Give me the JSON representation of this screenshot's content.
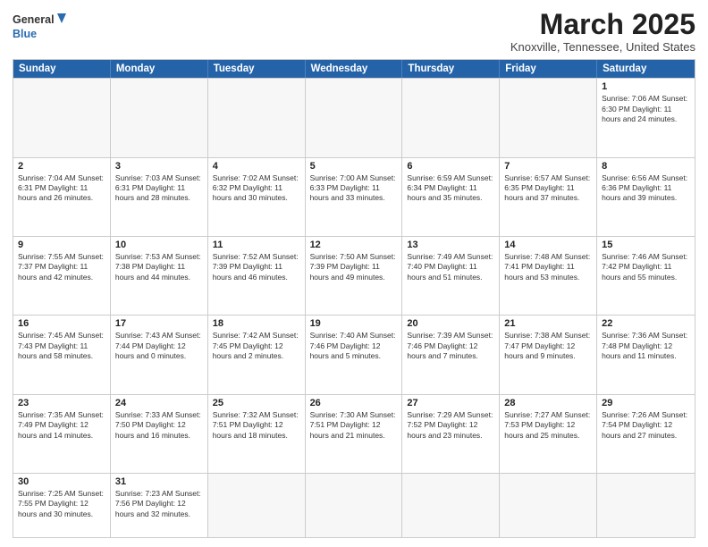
{
  "header": {
    "logo_line1": "General",
    "logo_line2": "Blue",
    "month_title": "March 2025",
    "location": "Knoxville, Tennessee, United States"
  },
  "days_of_week": [
    "Sunday",
    "Monday",
    "Tuesday",
    "Wednesday",
    "Thursday",
    "Friday",
    "Saturday"
  ],
  "weeks": [
    [
      {
        "day": "",
        "info": ""
      },
      {
        "day": "",
        "info": ""
      },
      {
        "day": "",
        "info": ""
      },
      {
        "day": "",
        "info": ""
      },
      {
        "day": "",
        "info": ""
      },
      {
        "day": "",
        "info": ""
      },
      {
        "day": "1",
        "info": "Sunrise: 7:06 AM\nSunset: 6:30 PM\nDaylight: 11 hours\nand 24 minutes."
      }
    ],
    [
      {
        "day": "2",
        "info": "Sunrise: 7:04 AM\nSunset: 6:31 PM\nDaylight: 11 hours\nand 26 minutes."
      },
      {
        "day": "3",
        "info": "Sunrise: 7:03 AM\nSunset: 6:31 PM\nDaylight: 11 hours\nand 28 minutes."
      },
      {
        "day": "4",
        "info": "Sunrise: 7:02 AM\nSunset: 6:32 PM\nDaylight: 11 hours\nand 30 minutes."
      },
      {
        "day": "5",
        "info": "Sunrise: 7:00 AM\nSunset: 6:33 PM\nDaylight: 11 hours\nand 33 minutes."
      },
      {
        "day": "6",
        "info": "Sunrise: 6:59 AM\nSunset: 6:34 PM\nDaylight: 11 hours\nand 35 minutes."
      },
      {
        "day": "7",
        "info": "Sunrise: 6:57 AM\nSunset: 6:35 PM\nDaylight: 11 hours\nand 37 minutes."
      },
      {
        "day": "8",
        "info": "Sunrise: 6:56 AM\nSunset: 6:36 PM\nDaylight: 11 hours\nand 39 minutes."
      }
    ],
    [
      {
        "day": "9",
        "info": "Sunrise: 7:55 AM\nSunset: 7:37 PM\nDaylight: 11 hours\nand 42 minutes."
      },
      {
        "day": "10",
        "info": "Sunrise: 7:53 AM\nSunset: 7:38 PM\nDaylight: 11 hours\nand 44 minutes."
      },
      {
        "day": "11",
        "info": "Sunrise: 7:52 AM\nSunset: 7:39 PM\nDaylight: 11 hours\nand 46 minutes."
      },
      {
        "day": "12",
        "info": "Sunrise: 7:50 AM\nSunset: 7:39 PM\nDaylight: 11 hours\nand 49 minutes."
      },
      {
        "day": "13",
        "info": "Sunrise: 7:49 AM\nSunset: 7:40 PM\nDaylight: 11 hours\nand 51 minutes."
      },
      {
        "day": "14",
        "info": "Sunrise: 7:48 AM\nSunset: 7:41 PM\nDaylight: 11 hours\nand 53 minutes."
      },
      {
        "day": "15",
        "info": "Sunrise: 7:46 AM\nSunset: 7:42 PM\nDaylight: 11 hours\nand 55 minutes."
      }
    ],
    [
      {
        "day": "16",
        "info": "Sunrise: 7:45 AM\nSunset: 7:43 PM\nDaylight: 11 hours\nand 58 minutes."
      },
      {
        "day": "17",
        "info": "Sunrise: 7:43 AM\nSunset: 7:44 PM\nDaylight: 12 hours\nand 0 minutes."
      },
      {
        "day": "18",
        "info": "Sunrise: 7:42 AM\nSunset: 7:45 PM\nDaylight: 12 hours\nand 2 minutes."
      },
      {
        "day": "19",
        "info": "Sunrise: 7:40 AM\nSunset: 7:46 PM\nDaylight: 12 hours\nand 5 minutes."
      },
      {
        "day": "20",
        "info": "Sunrise: 7:39 AM\nSunset: 7:46 PM\nDaylight: 12 hours\nand 7 minutes."
      },
      {
        "day": "21",
        "info": "Sunrise: 7:38 AM\nSunset: 7:47 PM\nDaylight: 12 hours\nand 9 minutes."
      },
      {
        "day": "22",
        "info": "Sunrise: 7:36 AM\nSunset: 7:48 PM\nDaylight: 12 hours\nand 11 minutes."
      }
    ],
    [
      {
        "day": "23",
        "info": "Sunrise: 7:35 AM\nSunset: 7:49 PM\nDaylight: 12 hours\nand 14 minutes."
      },
      {
        "day": "24",
        "info": "Sunrise: 7:33 AM\nSunset: 7:50 PM\nDaylight: 12 hours\nand 16 minutes."
      },
      {
        "day": "25",
        "info": "Sunrise: 7:32 AM\nSunset: 7:51 PM\nDaylight: 12 hours\nand 18 minutes."
      },
      {
        "day": "26",
        "info": "Sunrise: 7:30 AM\nSunset: 7:51 PM\nDaylight: 12 hours\nand 21 minutes."
      },
      {
        "day": "27",
        "info": "Sunrise: 7:29 AM\nSunset: 7:52 PM\nDaylight: 12 hours\nand 23 minutes."
      },
      {
        "day": "28",
        "info": "Sunrise: 7:27 AM\nSunset: 7:53 PM\nDaylight: 12 hours\nand 25 minutes."
      },
      {
        "day": "29",
        "info": "Sunrise: 7:26 AM\nSunset: 7:54 PM\nDaylight: 12 hours\nand 27 minutes."
      }
    ],
    [
      {
        "day": "30",
        "info": "Sunrise: 7:25 AM\nSunset: 7:55 PM\nDaylight: 12 hours\nand 30 minutes."
      },
      {
        "day": "31",
        "info": "Sunrise: 7:23 AM\nSunset: 7:56 PM\nDaylight: 12 hours\nand 32 minutes."
      },
      {
        "day": "",
        "info": ""
      },
      {
        "day": "",
        "info": ""
      },
      {
        "day": "",
        "info": ""
      },
      {
        "day": "",
        "info": ""
      },
      {
        "day": "",
        "info": ""
      }
    ]
  ]
}
